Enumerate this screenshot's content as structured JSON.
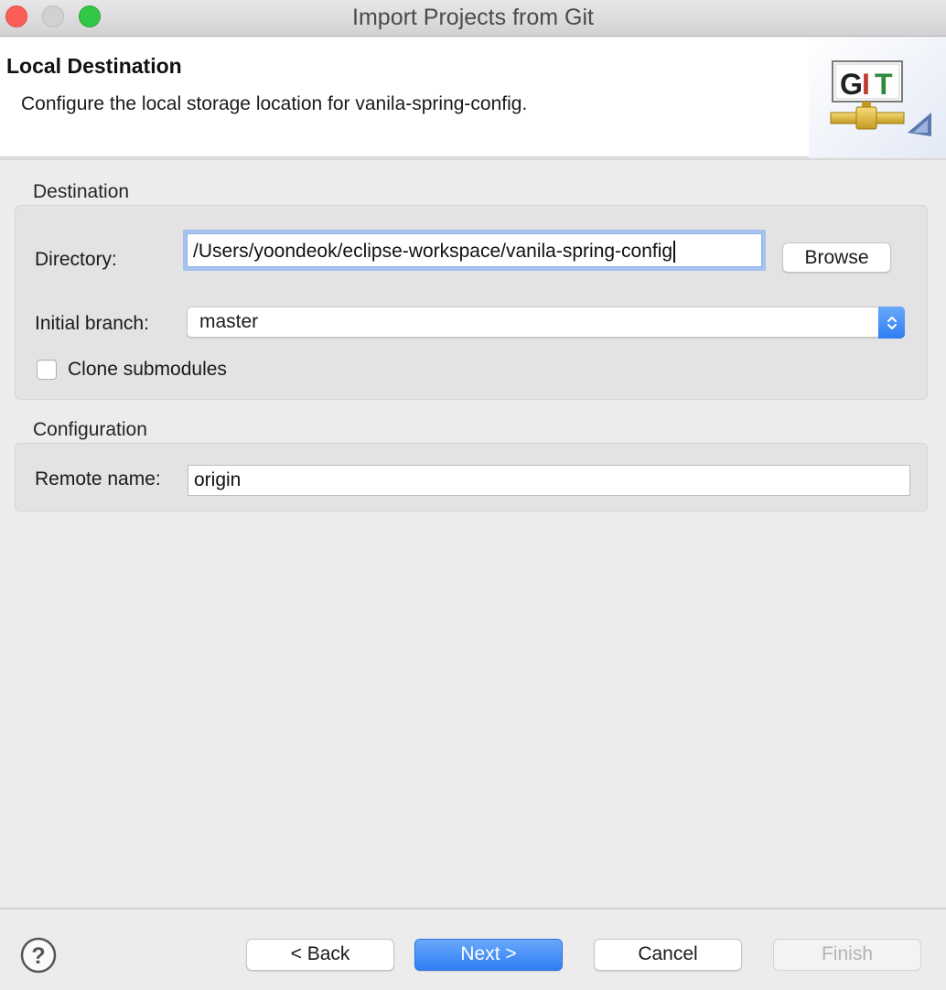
{
  "window": {
    "title": "Import Projects from Git"
  },
  "banner": {
    "title": "Local Destination",
    "description": "Configure the local storage location for vanila-spring-config.",
    "graphic_text": "GIT"
  },
  "destination": {
    "group_label": "Destination",
    "directory_label": "Directory:",
    "directory_value": "/Users/yoondeok/eclipse-workspace/vanila-spring-config",
    "browse_label": "Browse",
    "branch_label": "Initial branch:",
    "branch_value": "master",
    "clone_submodules_label": "Clone submodules",
    "clone_submodules_checked": false
  },
  "configuration": {
    "group_label": "Configuration",
    "remote_name_label": "Remote name:",
    "remote_name_value": "origin"
  },
  "footer": {
    "help_icon": "help-icon",
    "back_label": "< Back",
    "next_label": "Next >",
    "cancel_label": "Cancel",
    "finish_label": "Finish",
    "finish_enabled": false
  },
  "colors": {
    "accent": "#2f7ef4",
    "close": "#fc5f57",
    "maximize": "#33c748",
    "focus_ring": "#a5c2ef"
  }
}
